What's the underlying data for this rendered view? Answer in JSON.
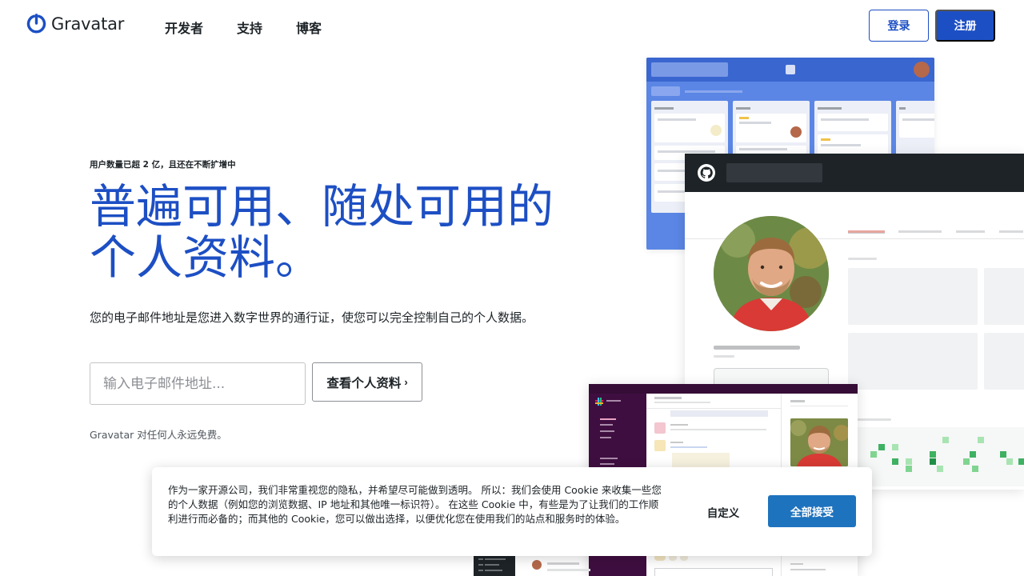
{
  "brand": {
    "name": "Gravatar",
    "accent": "#1d4fc4"
  },
  "nav": {
    "items": [
      "开发者",
      "支持",
      "博客"
    ]
  },
  "auth": {
    "login": "登录",
    "register": "注册"
  },
  "hero": {
    "eyebrow": "用户数量已超 2 亿，且还在不断扩增中",
    "headline_line1": "普遍可用、随处可用的",
    "headline_line2": "个人资料。",
    "description": "您的电子邮件地址是您进入数字世界的通行证，使您可以完全控制自己的个人数据。",
    "email_placeholder": "输入电子邮件地址...",
    "view_profile": "查看个人资料",
    "free_note": "Gravatar 对任何人永远免费。"
  },
  "cookie": {
    "text": "作为一家开源公司，我们非常重视您的隐私，并希望尽可能做到透明。 所以：我们会使用 Cookie 来收集一些您的个人数据（例如您的浏览数据、IP 地址和其他唯一标识符）。 在这些 Cookie 中，有些是为了让我们的工作顺利进行而必备的；而其他的 Cookie，您可以做出选择，以便优化您在使用我们的站点和服务时的体验。",
    "customize": "自定义",
    "accept_all": "全部接受"
  }
}
